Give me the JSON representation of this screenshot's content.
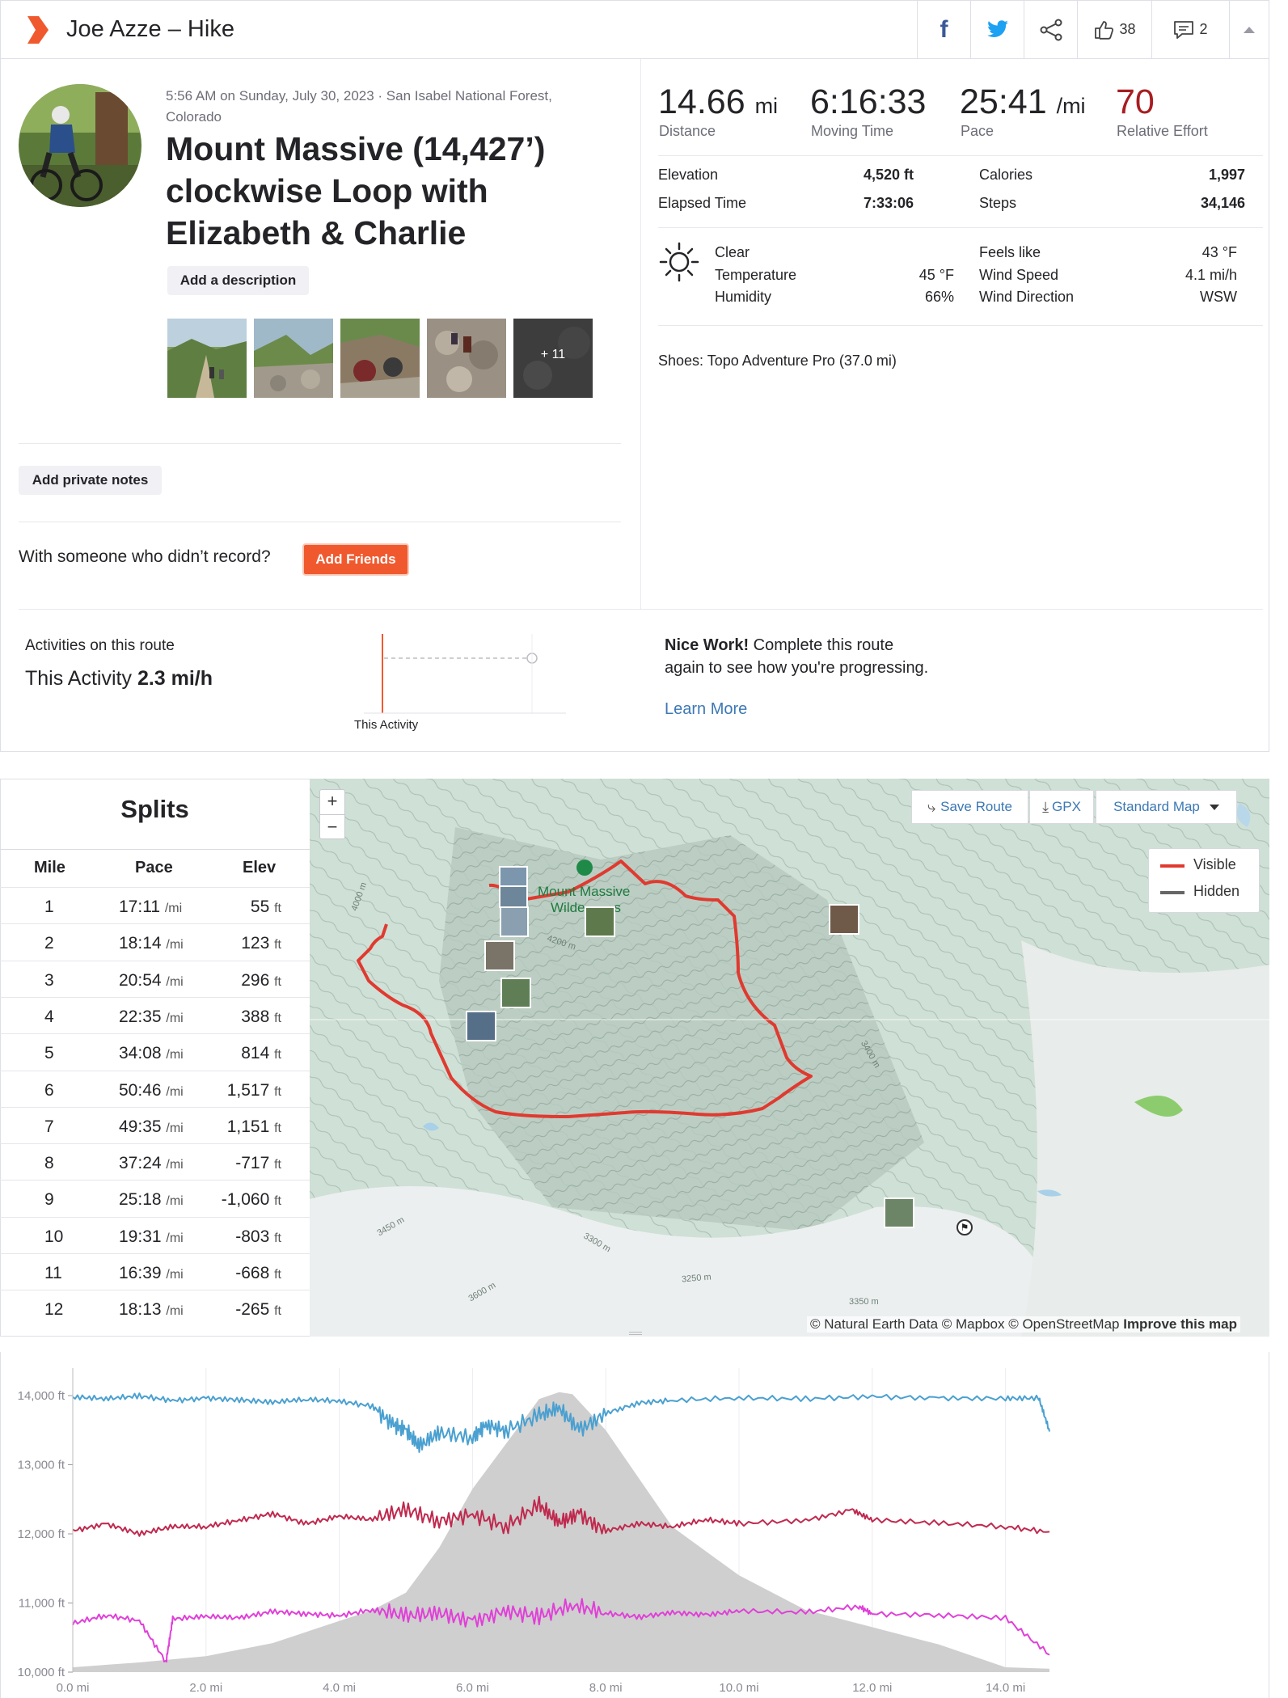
{
  "header": {
    "title": "Joe Azze – Hike",
    "kudos_count": "38",
    "comment_count": "2"
  },
  "activity": {
    "date_line": "5:56 AM on Sunday, July 30, 2023 · San Isabel National Forest, Colorado",
    "title": "Mount Massive (14,427’) clockwise Loop with Elizabeth & Charlie",
    "add_description": "Add a description",
    "photos_more": "+ 11",
    "add_private_notes": "Add private notes",
    "with_someone_text": "With someone who didn’t record?",
    "add_friends": "Add Friends"
  },
  "stats": {
    "distance_value": "14.66",
    "distance_unit": "mi",
    "distance_label": "Distance",
    "moving_time_value": "6:16:33",
    "moving_time_label": "Moving Time",
    "pace_value": "25:41",
    "pace_unit": "/mi",
    "pace_label": "Pace",
    "relative_effort_value": "70",
    "relative_effort_label": "Relative Effort",
    "relative_effort_color": "#a81d21",
    "elevation_label": "Elevation",
    "elevation_value": "4,520 ft",
    "elapsed_label": "Elapsed Time",
    "elapsed_value": "7:33:06",
    "calories_label": "Calories",
    "calories_value": "1,997",
    "steps_label": "Steps",
    "steps_value": "34,146"
  },
  "weather": {
    "condition": "Clear",
    "temperature_label": "Temperature",
    "temperature_value": "45 °F",
    "humidity_label": "Humidity",
    "humidity_value": "66%",
    "feels_like_label": "Feels like",
    "feels_like_value": "43 °F",
    "wind_speed_label": "Wind Speed",
    "wind_speed_value": "4.1 mi/h",
    "wind_direction_label": "Wind Direction",
    "wind_direction_value": "WSW"
  },
  "gear": {
    "shoes": "Shoes: Topo Adventure Pro (37.0 mi)"
  },
  "route": {
    "activities_label": "Activities on this route",
    "this_activity_prefix": "This Activity",
    "this_activity_speed": "2.3 mi/h",
    "chart_label": "This Activity",
    "nice_work_bold": "Nice Work!",
    "nice_work_text": "Complete this route again to see how you're progressing.",
    "learn_more": "Learn More",
    "accent_color": "#f0592e"
  },
  "splits": {
    "title": "Splits",
    "headers": [
      "Mile",
      "Pace",
      "Elev"
    ],
    "pace_unit": "/mi",
    "elev_unit": "ft",
    "rows": [
      {
        "mile": "1",
        "pace": "17:11",
        "elev": "55"
      },
      {
        "mile": "2",
        "pace": "18:14",
        "elev": "123"
      },
      {
        "mile": "3",
        "pace": "20:54",
        "elev": "296"
      },
      {
        "mile": "4",
        "pace": "22:35",
        "elev": "388"
      },
      {
        "mile": "5",
        "pace": "34:08",
        "elev": "814"
      },
      {
        "mile": "6",
        "pace": "50:46",
        "elev": "1,517"
      },
      {
        "mile": "7",
        "pace": "49:35",
        "elev": "1,151"
      },
      {
        "mile": "8",
        "pace": "37:24",
        "elev": "-717"
      },
      {
        "mile": "9",
        "pace": "25:18",
        "elev": "-1,060"
      },
      {
        "mile": "10",
        "pace": "19:31",
        "elev": "-803"
      },
      {
        "mile": "11",
        "pace": "16:39",
        "elev": "-668"
      },
      {
        "mile": "12",
        "pace": "18:13",
        "elev": "-265"
      }
    ]
  },
  "map": {
    "zoom_in": "+",
    "zoom_out": "−",
    "save_route": "Save Route",
    "gpx": "GPX",
    "map_style": "Standard Map",
    "legend_visible": "Visible",
    "legend_hidden": "Hidden",
    "peak_label_line1": "Mount Massive",
    "peak_label_line2": "Wilde",
    "peak_label_line2b": "s",
    "contour_labels": [
      "4200 m",
      "3400 m",
      "3450 m",
      "3300 m",
      "3250 m",
      "3600 m",
      "3350 m",
      "4000 m"
    ],
    "attribution": "© Natural Earth Data © Mapbox © OpenStreetMap",
    "improve": "Improve this map",
    "route_color": "#e03a30",
    "hidden_color": "#666666"
  },
  "chart_data": {
    "type": "area",
    "x_unit": "mi",
    "xlim": [
      0,
      14.66
    ],
    "ylim": [
      10000,
      14000
    ],
    "x_ticks": [
      "0.0 mi",
      "2.0 mi",
      "4.0 mi",
      "6.0 mi",
      "8.0 mi",
      "10.0 mi",
      "12.0 mi",
      "14.0 mi"
    ],
    "y_ticks": [
      "14,000 ft",
      "13,000 ft",
      "12,000 ft",
      "11,000 ft",
      "10,000 ft"
    ],
    "elevation_profile": {
      "color": "#cfcfcf",
      "x": [
        0,
        1,
        2,
        3,
        4,
        4.5,
        5,
        5.5,
        6,
        6.5,
        7,
        7.3,
        7.5,
        8,
        8.5,
        9,
        10,
        11,
        12,
        13,
        14,
        14.66
      ],
      "y": [
        10070,
        10140,
        10230,
        10420,
        10740,
        10900,
        11150,
        11800,
        12650,
        13300,
        13950,
        14050,
        14020,
        13500,
        12800,
        12100,
        11400,
        10900,
        10650,
        10400,
        10070,
        10050
      ]
    },
    "series": [
      {
        "color": "#4aa0d0",
        "x": [
          0,
          0.5,
          1,
          1.5,
          2,
          2.5,
          3,
          3.5,
          4,
          4.5,
          4.8,
          5,
          5.2,
          5.5,
          6,
          6.2,
          6.5,
          7,
          7.3,
          7.6,
          8,
          8.5,
          9,
          10,
          11,
          12,
          13,
          14,
          14.5,
          14.66
        ],
        "y": [
          13980,
          13950,
          13990,
          13930,
          13970,
          13940,
          13900,
          13940,
          13920,
          13850,
          13600,
          13500,
          13250,
          13450,
          13400,
          13600,
          13500,
          13700,
          13800,
          13500,
          13750,
          13900,
          13930,
          13960,
          13950,
          13990,
          13970,
          13960,
          13960,
          13480
        ]
      },
      {
        "color": "#c0294e",
        "x": [
          0,
          0.5,
          1,
          1.5,
          2,
          2.5,
          3,
          3.5,
          4,
          4.5,
          5,
          5.5,
          6,
          6.5,
          7,
          7.3,
          7.6,
          8,
          8.5,
          9,
          9.5,
          10,
          11,
          11.7,
          12,
          13,
          14,
          14.66
        ],
        "y": [
          12050,
          12150,
          12000,
          12100,
          12100,
          12200,
          12300,
          12150,
          12250,
          12200,
          12350,
          12200,
          12300,
          12100,
          12400,
          12150,
          12300,
          12050,
          12150,
          12100,
          12200,
          12150,
          12200,
          12350,
          12200,
          12150,
          12100,
          12030
        ]
      },
      {
        "color": "#e040d8",
        "x": [
          0,
          0.5,
          1,
          1.4,
          1.5,
          2,
          2.5,
          3,
          3.5,
          4,
          4.5,
          5,
          5.5,
          6,
          6.5,
          7,
          7.5,
          8,
          8.5,
          9,
          9.5,
          10,
          11,
          11.8,
          12,
          13,
          14,
          14.66
        ],
        "y": [
          10700,
          10820,
          10750,
          10150,
          10770,
          10800,
          10780,
          10880,
          10850,
          10820,
          10900,
          10800,
          10850,
          10750,
          10900,
          10800,
          10950,
          10850,
          10800,
          10870,
          10830,
          10880,
          10860,
          10950,
          10850,
          10830,
          10780,
          10250
        ]
      }
    ]
  }
}
